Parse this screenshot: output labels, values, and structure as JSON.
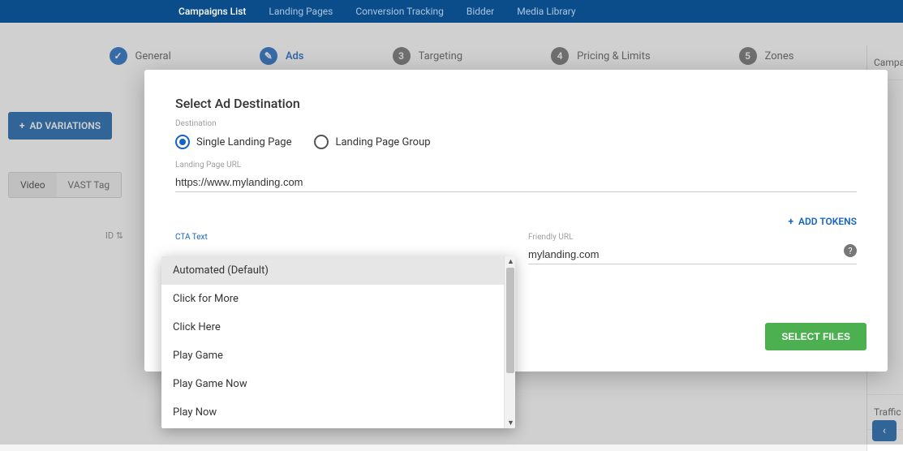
{
  "nav": {
    "items": [
      {
        "label": "Campaigns List",
        "active": true
      },
      {
        "label": "Landing Pages"
      },
      {
        "label": "Conversion Tracking"
      },
      {
        "label": "Bidder"
      },
      {
        "label": "Media Library"
      }
    ]
  },
  "stepper": [
    {
      "label": "General",
      "state": "done"
    },
    {
      "label": "Ads",
      "state": "active"
    },
    {
      "label": "Targeting",
      "state": "pending",
      "num": "3"
    },
    {
      "label": "Pricing & Limits",
      "state": "pending",
      "num": "4"
    },
    {
      "label": "Zones",
      "state": "pending",
      "num": "5"
    }
  ],
  "left": {
    "ad_variations": "AD VARIATIONS",
    "tabs": [
      "Video",
      "VAST Tag"
    ],
    "id_label": "ID"
  },
  "right": {
    "items": [
      "Campaign",
      "Traffic"
    ]
  },
  "modal": {
    "title": "Select Ad Destination",
    "destination_label": "Destination",
    "radios": [
      {
        "label": "Single Landing Page",
        "selected": true
      },
      {
        "label": "Landing Page Group",
        "selected": false
      }
    ],
    "landing_url_label": "Landing Page URL",
    "landing_url_value": "https://www.mylanding.com",
    "cta_label": "CTA Text",
    "friendly_label": "Friendly URL",
    "friendly_value": "mylanding.com",
    "add_tokens": "ADD TOKENS",
    "select_files": "SELECT FILES"
  },
  "cta_options": [
    "Automated (Default)",
    "Click for More",
    "Click Here",
    "Play Game",
    "Play Game Now",
    "Play Now"
  ]
}
